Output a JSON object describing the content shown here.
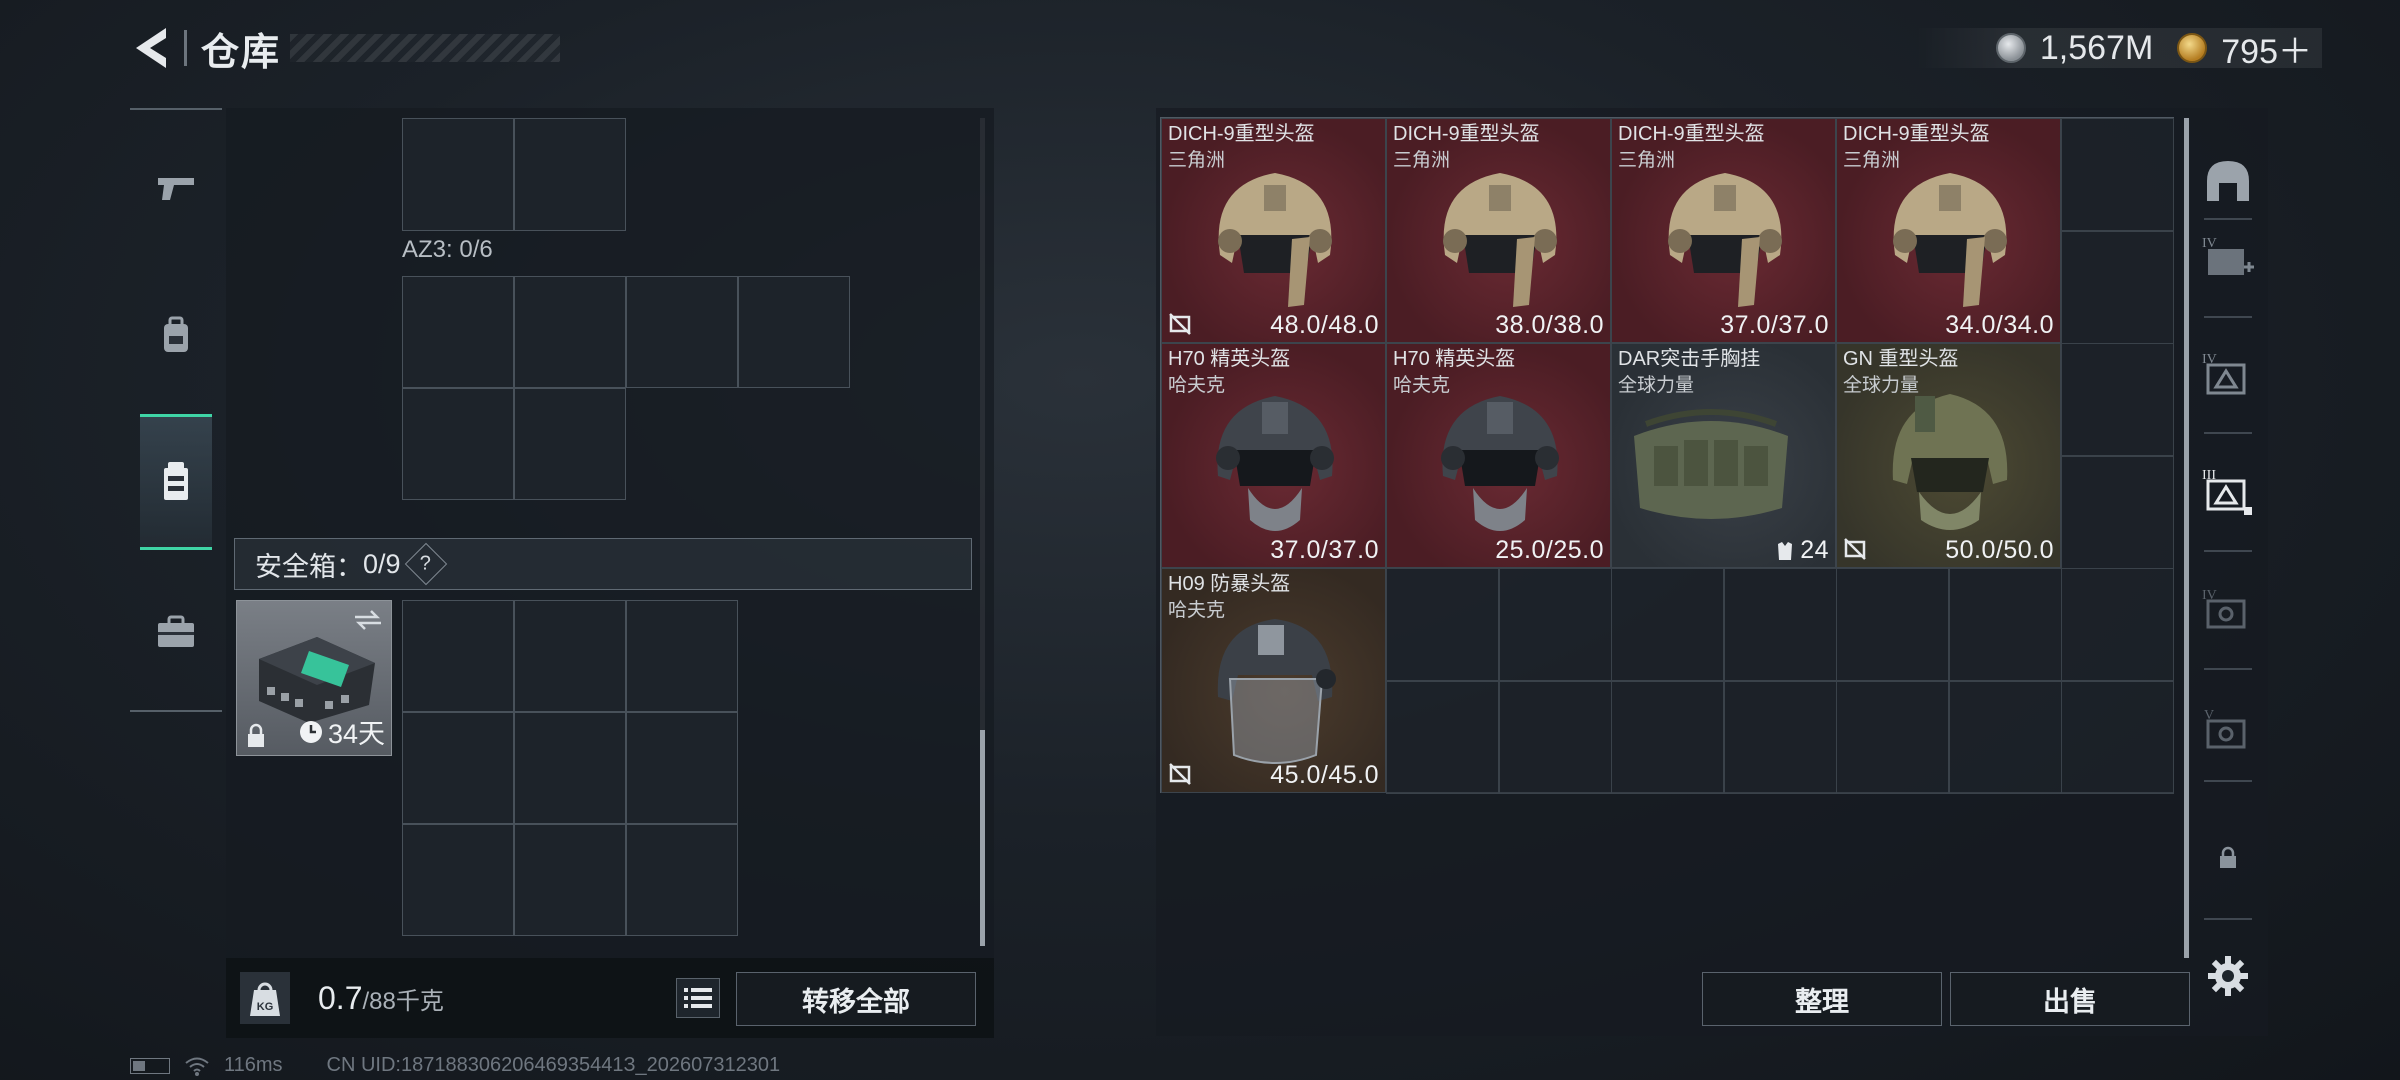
{
  "header": {
    "title": "仓库",
    "currencies": [
      {
        "icon": "silver-coin-icon",
        "value": "1,567M"
      },
      {
        "icon": "gold-coin-icon",
        "value": "795＋"
      }
    ]
  },
  "left_rail": [
    {
      "icon": "pistol-icon",
      "active": false
    },
    {
      "icon": "backpack-icon",
      "active": false
    },
    {
      "icon": "chest-rig-icon",
      "active": true
    },
    {
      "icon": "briefcase-icon",
      "active": false
    }
  ],
  "storage": {
    "container_label": "AZ3: 0/6",
    "safe_label": "安全箱：",
    "safe_count": "0/9",
    "safe_help": "?",
    "safe_days": "34天",
    "weight_current": "0.7",
    "weight_max": "/88千克",
    "transfer_all": "转移全部"
  },
  "stash_items": [
    {
      "name": "DICH-9重型头盔",
      "sub": "三角洲",
      "durability": "48.0/48.0",
      "color": "red",
      "art": "helmet-tan",
      "noicon": true
    },
    {
      "name": "DICH-9重型头盔",
      "sub": "三角洲",
      "durability": "38.0/38.0",
      "color": "red",
      "art": "helmet-tan",
      "noicon": false
    },
    {
      "name": "DICH-9重型头盔",
      "sub": "三角洲",
      "durability": "37.0/37.0",
      "color": "red",
      "art": "helmet-tan",
      "noicon": false
    },
    {
      "name": "DICH-9重型头盔",
      "sub": "三角洲",
      "durability": "34.0/34.0",
      "color": "red",
      "art": "helmet-tan",
      "noicon": false
    },
    {
      "name": "H70 精英头盔",
      "sub": "哈夫克",
      "durability": "37.0/37.0",
      "color": "red",
      "art": "helmet-dark",
      "noicon": false
    },
    {
      "name": "H70 精英头盔",
      "sub": "哈夫克",
      "durability": "25.0/25.0",
      "color": "red",
      "art": "helmet-dark",
      "noicon": false
    },
    {
      "name": "DAR突击手胸挂",
      "sub": "全球力量",
      "durability": "24",
      "color": "gray",
      "art": "rig",
      "noicon": false,
      "capacity": true
    },
    {
      "name": "GN 重型头盔",
      "sub": "全球力量",
      "durability": "50.0/50.0",
      "color": "olive",
      "art": "helmet-olive",
      "noicon": true
    },
    {
      "name": "H09 防暴头盔",
      "sub": "哈夫克",
      "durability": "45.0/45.0",
      "color": "brown",
      "art": "helmet-riot",
      "noicon": true
    }
  ],
  "buttons": {
    "organize": "整理",
    "sell": "出售"
  },
  "right_rail": [
    {
      "icon": "helmet-slot-icon"
    },
    {
      "icon": "armor-iv-plus-icon",
      "tier": "IV"
    },
    {
      "icon": "armor-iv-icon",
      "tier": "IV"
    },
    {
      "icon": "armor-iii-active-icon",
      "tier": "III"
    },
    {
      "icon": "armor-iv-locked-icon",
      "tier": "IV"
    },
    {
      "icon": "armor-v-locked-icon",
      "tier": "V"
    },
    {
      "icon": "lock-icon"
    },
    {
      "icon": "gear-icon"
    }
  ],
  "status": {
    "ping": "116ms",
    "uid": "CN UID:18718830620646935441З_202607312301"
  }
}
